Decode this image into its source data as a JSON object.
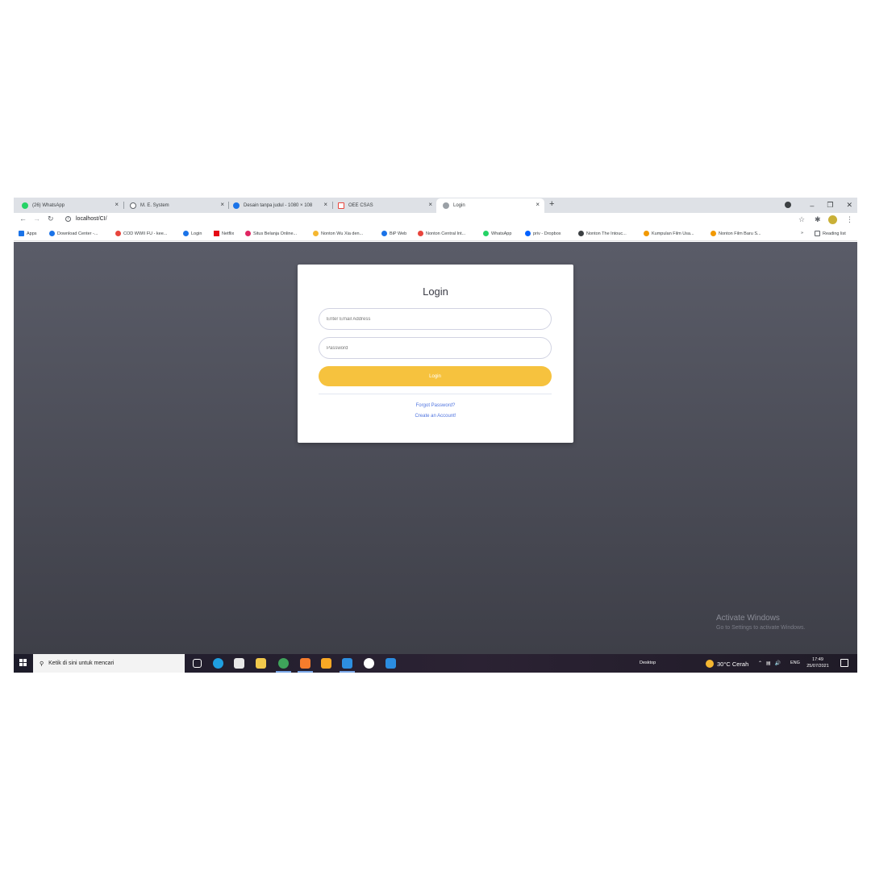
{
  "browser": {
    "tabs": [
      {
        "title": "(26) WhatsApp",
        "icon": "whatsapp-icon",
        "color": "#25d366"
      },
      {
        "title": "M. E. System",
        "icon": "refresh-icon",
        "color": "#5f6368"
      },
      {
        "title": "Desain tanpa judul - 1080 × 108",
        "icon": "canva-icon",
        "color": "#1a73e8"
      },
      {
        "title": "OEE CSAS",
        "icon": "document-icon",
        "color": "#e8453c"
      },
      {
        "title": "Login",
        "icon": "globe-icon",
        "color": "#9aa0a6"
      }
    ],
    "close_glyph": "×",
    "new_tab_glyph": "+",
    "url": "localhost/CI/",
    "bookmarks": [
      {
        "label": "Apps",
        "color": "#1a73e8"
      },
      {
        "label": "Download Center -...",
        "color": "#1a73e8"
      },
      {
        "label": "COD WWII FU - kee...",
        "color": "#e8453c"
      },
      {
        "label": "Login",
        "color": "#1a73e8"
      },
      {
        "label": "Netflix",
        "color": "#e50914"
      },
      {
        "label": "Situs Belanja Online...",
        "color": "#e02662"
      },
      {
        "label": "Nonton Wu Xia den...",
        "color": "#f5b731"
      },
      {
        "label": "BiP Web",
        "color": "#1a73e8"
      },
      {
        "label": "Nonton Central Int...",
        "color": "#e8453c"
      },
      {
        "label": "WhatsApp",
        "color": "#25d366"
      },
      {
        "label": "priv - Dropbox",
        "color": "#0061ff"
      },
      {
        "label": "Nonton The Intouc...",
        "color": "#3c4043"
      },
      {
        "label": "Kumpulan Film Usa...",
        "color": "#f29900"
      },
      {
        "label": "Nonton Film Baru S...",
        "color": "#f29900"
      }
    ],
    "bookmarks_more": "»",
    "reading_list": "Reading list"
  },
  "login": {
    "title": "Login",
    "email_placeholder": "Enter Email Address",
    "password_placeholder": "Password",
    "button_label": "Login",
    "forgot_password": "Forgot Password?",
    "create_account": "Create an Account!"
  },
  "watermark": {
    "title": "Activate Windows",
    "subtitle": "Go to Settings to activate Windows."
  },
  "taskbar": {
    "search_placeholder": "Ketik di sini untuk mencari",
    "desktop_label": "Desktop",
    "weather": "30°C  Cerah",
    "language": "ENG",
    "time": "17:49",
    "date": "25/07/2021"
  },
  "colors": {
    "accent_button": "#f6c23e",
    "link": "#4e73df",
    "page_bg_top": "#5a5c68",
    "page_bg_bottom": "#3e3f48"
  }
}
